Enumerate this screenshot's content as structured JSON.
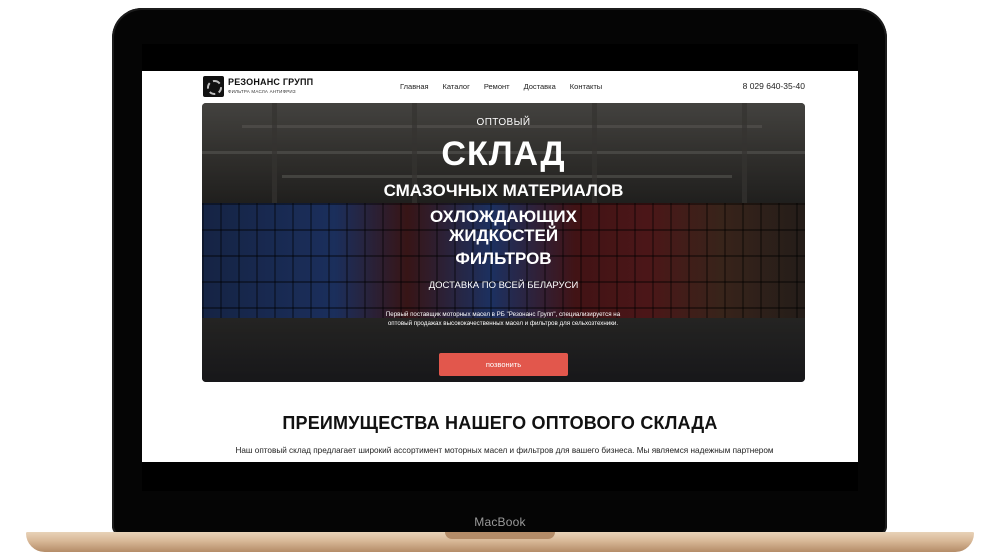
{
  "device": {
    "brand_label": "MacBook"
  },
  "site": {
    "logo": {
      "title": "РЕЗОНАНС ГРУПП",
      "subtitle": "ФИЛЬТРА МАСЛА АНТИФРИЗ"
    },
    "nav": [
      "Главная",
      "Каталог",
      "Ремонт",
      "Доставка",
      "Контакты"
    ],
    "phone": "8 029 640-35-40"
  },
  "hero": {
    "kicker": "ОПТОВЫЙ",
    "title": "СКЛАД",
    "lines": [
      "СМАЗОЧНЫХ МАТЕРИАЛОВ",
      "ОХЛОЖДАЮЩИХ",
      "ЖИДКОСТЕЙ",
      "ФИЛЬТРОВ"
    ],
    "delivery": "ДОСТАВКА ПО ВСЕЙ БЕЛАРУСИ",
    "description": "Первый поставщик моторных масел в РБ \"Резонанс Групп\", специализируется на оптовый продажах высококачественных масел и фильтров для сельхозтехники.",
    "cta_label": "позвонить"
  },
  "advantages": {
    "title": "ПРЕИМУЩЕСТВА НАШЕГО ОПТОВОГО СКЛАДА",
    "text": "Наш оптовый склад предлагает широкий ассортимент моторных масел и фильтров для вашего бизнеса. Мы являемся надежным партнером"
  },
  "colors": {
    "cta": "#e2574c",
    "laptop_frame": "#050505",
    "laptop_base": "#d8b897"
  }
}
